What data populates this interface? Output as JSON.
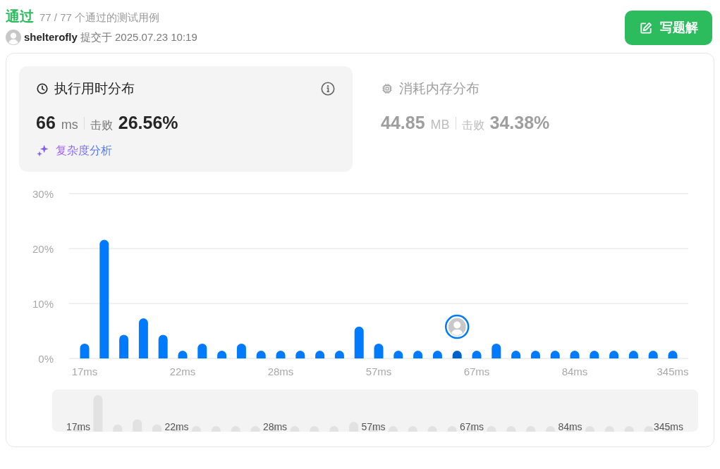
{
  "status": {
    "label": "通过",
    "summary": "77 / 77 个通过的测试用例"
  },
  "submission": {
    "user": "shelterofly",
    "submitted": "提交于 2025.07.23 10:19"
  },
  "write_solution_button": {
    "label": "写题解"
  },
  "metrics": [
    {
      "kind": "runtime",
      "title": "执行用时分布",
      "value": "66",
      "unit": "ms",
      "beats_label": "击败",
      "beats": "26.56%",
      "selected": true,
      "link": "复杂度分析"
    },
    {
      "kind": "memory",
      "title": "消耗内存分布",
      "value": "44.85",
      "unit": "MB",
      "beats_label": "击败",
      "beats": "34.38%",
      "selected": false
    }
  ],
  "chart": {
    "chart_data": {
      "type": "bar",
      "categories": [
        "17ms",
        null,
        null,
        null,
        null,
        "22ms",
        null,
        null,
        null,
        null,
        "28ms",
        null,
        null,
        null,
        null,
        "57ms",
        null,
        null,
        null,
        null,
        "67ms",
        null,
        null,
        null,
        null,
        "84ms",
        null,
        null,
        null,
        null,
        "345ms"
      ],
      "values": [
        2.7,
        21.6,
        4.3,
        7.3,
        4.3,
        1.4,
        2.7,
        1.4,
        2.7,
        1.4,
        1.4,
        1.4,
        1.4,
        1.4,
        5.8,
        2.7,
        1.4,
        1.4,
        1.4,
        1.4,
        1.4,
        2.7,
        1.4,
        1.4,
        1.4,
        1.4,
        1.4,
        1.4,
        1.4,
        1.4,
        1.4
      ],
      "ylim": [
        0,
        30
      ],
      "yticks": [
        {
          "value": 0,
          "label": "0%"
        },
        {
          "value": 10,
          "label": "10%"
        },
        {
          "value": 20,
          "label": "20%"
        },
        {
          "value": 30,
          "label": "30%"
        }
      ]
    },
    "bars": [
      {
        "selected": false
      },
      {
        "selected": false
      },
      {
        "selected": false
      },
      {
        "selected": false
      },
      {
        "selected": false
      },
      {
        "selected": false
      },
      {
        "selected": false
      },
      {
        "selected": false
      },
      {
        "selected": false
      },
      {
        "selected": false
      },
      {
        "selected": false
      },
      {
        "selected": false
      },
      {
        "selected": false
      },
      {
        "selected": false
      },
      {
        "selected": false
      },
      {
        "selected": false
      },
      {
        "selected": false
      },
      {
        "selected": false
      },
      {
        "selected": false
      },
      {
        "selected": true
      },
      {
        "selected": false
      },
      {
        "selected": false
      },
      {
        "selected": false
      },
      {
        "selected": false
      },
      {
        "selected": false
      },
      {
        "selected": false
      },
      {
        "selected": false
      },
      {
        "selected": false
      },
      {
        "selected": false
      },
      {
        "selected": false
      },
      {
        "selected": false
      }
    ]
  },
  "overview": {
    "labels": [
      "17ms",
      "22ms",
      "28ms",
      "57ms",
      "67ms",
      "84ms",
      "345ms"
    ]
  }
}
